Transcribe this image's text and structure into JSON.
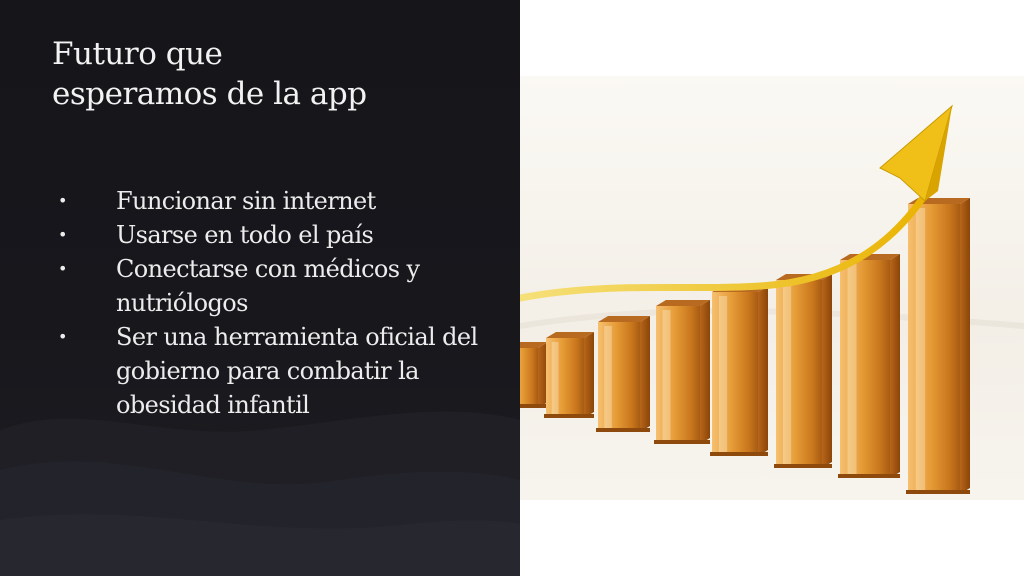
{
  "slide": {
    "title_lines": [
      "Futuro que",
      "esperamos de la app"
    ],
    "bullets": [
      "Funcionar sin internet",
      "Usarse en todo el país",
      "Conectarse con médicos y nutriólogos",
      "Ser una herramienta oficial del gobierno para combatir la obesidad infantil"
    ]
  },
  "image": {
    "icon": "growth-bar-chart-with-rising-arrow",
    "bar_color": "#e8a040",
    "arrow_color": "#f2c21a"
  }
}
